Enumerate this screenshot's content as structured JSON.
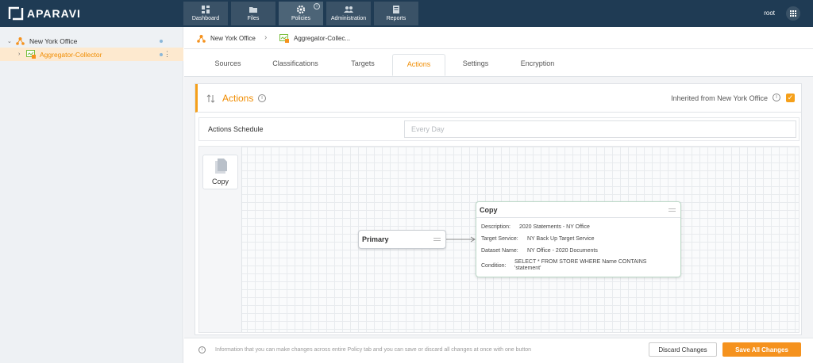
{
  "app": {
    "logo_text": "APARAVI",
    "user": "root",
    "accent": "#f5921e",
    "topbar_color": "#1f3b54"
  },
  "nav": [
    {
      "label": "Dashboard",
      "icon": "dashboard-icon"
    },
    {
      "label": "Files",
      "icon": "folder-icon"
    },
    {
      "label": "Policies",
      "icon": "gear-icon",
      "active": true
    },
    {
      "label": "Administration",
      "icon": "users-icon"
    },
    {
      "label": "Reports",
      "icon": "reports-icon"
    }
  ],
  "sidebar": {
    "items": [
      {
        "label": "New York Office",
        "icon": "network-icon"
      },
      {
        "label": "Aggregator-Collector",
        "icon": "collector-icon",
        "selected": true
      }
    ]
  },
  "breadcrumb": {
    "first": "New York Office",
    "second": "Aggregator-Collec..."
  },
  "tabs": [
    "Sources",
    "Classifications",
    "Targets",
    "Actions",
    "Settings",
    "Encryption"
  ],
  "active_tab": "Actions",
  "panel": {
    "title": "Actions",
    "inherited": "Inherited from New York Office",
    "schedule_label": "Actions Schedule",
    "schedule_placeholder": "Every Day"
  },
  "palette": {
    "copy_label": "Copy"
  },
  "nodes": {
    "primary": {
      "title": "Primary"
    },
    "copy": {
      "title": "Copy",
      "fields": [
        {
          "key": "Description:",
          "value": "2020 Statements - NY Office"
        },
        {
          "key": "Target Service:",
          "value": "NY Back Up Target Service"
        },
        {
          "key": "Dataset Name:",
          "value": "NY Office - 2020 Documents"
        },
        {
          "key": "Condition:",
          "value_line1": "SELECT * FROM STORE WHERE Name CONTAINS",
          "value_line2": "'statement'"
        }
      ]
    }
  },
  "footer": {
    "info": "Information that you can make changes across entire Policy tab and you can save or discard all changes at once with one button",
    "discard_label": "Discard Changes",
    "save_label": "Save All Changes"
  }
}
